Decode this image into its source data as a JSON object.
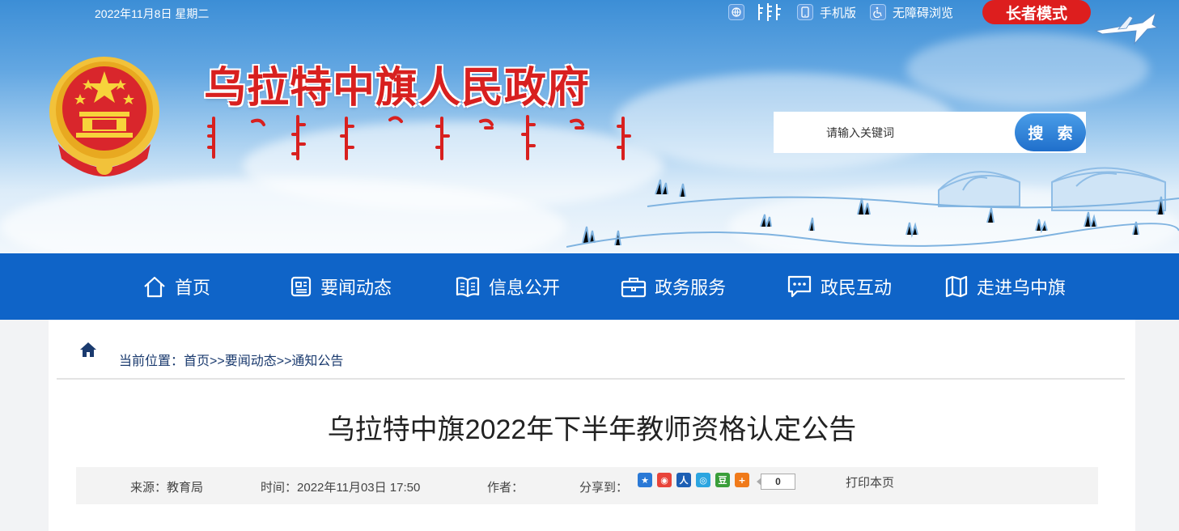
{
  "header": {
    "date": "2022年11月8日 星期二",
    "toolbar": {
      "mobile_label": "手机版",
      "accessibility_label": "无障碍浏览",
      "elder_mode_label": "长者模式"
    },
    "site_title": "乌拉特中旗人民政府",
    "search": {
      "placeholder": "请输入关键词",
      "button_label": "搜 索"
    }
  },
  "nav": {
    "items": [
      {
        "label": "首页",
        "icon": "home-icon"
      },
      {
        "label": "要闻动态",
        "icon": "news-icon"
      },
      {
        "label": "信息公开",
        "icon": "book-icon"
      },
      {
        "label": "政务服务",
        "icon": "briefcase-icon"
      },
      {
        "label": "政民互动",
        "icon": "chat-icon"
      },
      {
        "label": "走进乌中旗",
        "icon": "map-icon"
      }
    ]
  },
  "breadcrumb": {
    "prefix": "当前位置：",
    "items": [
      "首页",
      "要闻动态",
      "通知公告"
    ],
    "separator": ">>"
  },
  "article": {
    "title": "乌拉特中旗2022年下半年教师资格认定公告",
    "source_label": "来源：",
    "source_value": "教育局",
    "time_label": "时间：",
    "time_value": "2022年11月03日 17:50",
    "author_label": "作者：",
    "author_value": "",
    "share_label": "分享到：",
    "share_count": "0",
    "print_label": "打印本页"
  },
  "colors": {
    "nav_bg": "#0f64c8",
    "title_red": "#d8201f",
    "elder_red": "#dd1e1e"
  }
}
